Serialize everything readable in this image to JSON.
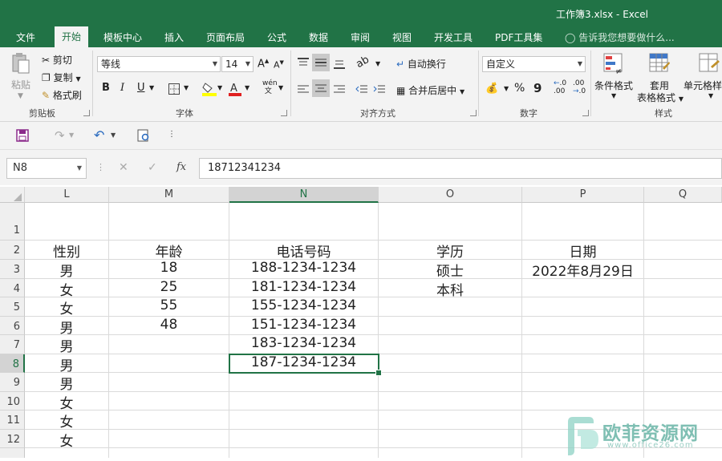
{
  "window": {
    "title": "工作簿3.xlsx - Excel"
  },
  "tabs": [
    "文件",
    "开始",
    "模板中心",
    "插入",
    "页面布局",
    "公式",
    "数据",
    "审阅",
    "视图",
    "开发工具",
    "PDF工具集"
  ],
  "active_tab": "开始",
  "tell_me": "告诉我您想要做什么...",
  "ribbon": {
    "clipboard": {
      "paste": "粘贴",
      "cut": "剪切",
      "copy": "复制",
      "format_painter": "格式刷",
      "label": "剪贴板"
    },
    "font": {
      "name": "等线",
      "size": "14",
      "bold": "B",
      "italic": "I",
      "underline": "U",
      "label": "字体"
    },
    "alignment": {
      "wrap": "自动换行",
      "merge": "合并后居中",
      "label": "对齐方式"
    },
    "number": {
      "format": "自定义",
      "percent": "%",
      "comma": "9",
      "inc_decimal": ".00",
      "dec_decimal": ".00",
      "label": "数字"
    },
    "styles": {
      "conditional": "条件格式",
      "table_line1": "套用",
      "table_line2": "表格格式",
      "cell_styles": "单元格样",
      "label": "样式"
    }
  },
  "formula_bar": {
    "name_box": "N8",
    "value": "18712341234",
    "fx": "fx"
  },
  "columns": [
    "L",
    "M",
    "N",
    "O",
    "P",
    "Q"
  ],
  "selected_column": "N",
  "rows": [
    "1",
    "2",
    "3",
    "4",
    "5",
    "6",
    "7",
    "8",
    "9",
    "10",
    "11",
    "12"
  ],
  "selected_row": "8",
  "sheet": {
    "L": [
      "",
      "性别",
      "男",
      "女",
      "女",
      "男",
      "男",
      "男",
      "男",
      "女",
      "女",
      "女"
    ],
    "M": [
      "",
      "年龄",
      "18",
      "25",
      "55",
      "48",
      "",
      "",
      "",
      "",
      "",
      ""
    ],
    "N": [
      "",
      "电话号码",
      "188-1234-1234",
      "181-1234-1234",
      "155-1234-1234",
      "151-1234-1234",
      "183-1234-1234",
      "187-1234-1234",
      "",
      "",
      "",
      ""
    ],
    "O": [
      "",
      "学历",
      "硕士",
      "本科",
      "",
      "",
      "",
      "",
      "",
      "",
      "",
      ""
    ],
    "P": [
      "",
      "日期",
      "2022年8月29日",
      "",
      "",
      "",
      "",
      "",
      "",
      "",
      "",
      ""
    ]
  },
  "watermark": {
    "text": "欧菲资源网",
    "url": "www.office26.com"
  },
  "colors": {
    "accent": "#217346"
  }
}
